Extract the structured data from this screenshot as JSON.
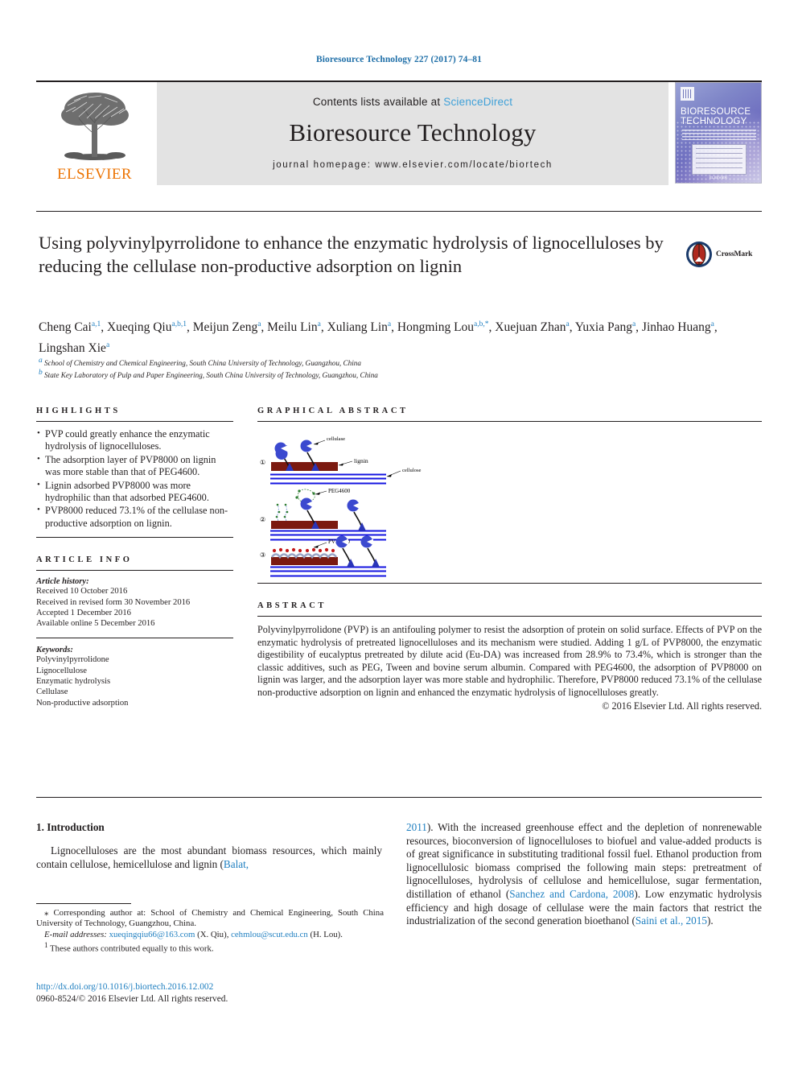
{
  "running_head": "Bioresource Technology 227 (2017) 74–81",
  "masthead": {
    "publisher": "ELSEVIER",
    "contents_prefix": "Contents lists available at ",
    "sciencedirect": "ScienceDirect",
    "journal_title": "Bioresource Technology",
    "homepage": "journal homepage: www.elsevier.com/locate/biortech",
    "cover_title_line1": "BIORESOURCE",
    "cover_title_line2": "TECHNOLOGY",
    "cover_footer": "ELSEVIER"
  },
  "article": {
    "title": "Using polyvinylpyrrolidone to enhance the enzymatic hydrolysis of lignocelluloses by reducing the cellulase non-productive adsorption on lignin",
    "crossmark_label": "CrossMark",
    "authors_line1_parts": [
      {
        "name": "Cheng Cai",
        "sup": "a,1"
      },
      {
        "name": "Xueqing Qiu",
        "sup": "a,b,1"
      },
      {
        "name": "Meijun Zeng",
        "sup": "a"
      },
      {
        "name": "Meilu Lin",
        "sup": "a"
      },
      {
        "name": "Xuliang Lin",
        "sup": "a"
      },
      {
        "name": "Hongming Lou",
        "sup": "a,b,*"
      },
      {
        "name": "Xuejuan Zhan",
        "sup": "a"
      },
      {
        "name": "Yuxia Pang",
        "sup": "a"
      },
      {
        "name": "Jinhao Huang",
        "sup": "a"
      },
      {
        "name": "Lingshan Xie",
        "sup": "a"
      }
    ],
    "affiliations": [
      {
        "sup": "a",
        "text": "School of Chemistry and Chemical Engineering, South China University of Technology, Guangzhou, China"
      },
      {
        "sup": "b",
        "text": "State Key Laboratory of Pulp and Paper Engineering, South China University of Technology, Guangzhou, China"
      }
    ]
  },
  "highlights": {
    "heading": "HIGHLIGHTS",
    "items": [
      "PVP could greatly enhance the enzymatic hydrolysis of lignocelluloses.",
      "The adsorption layer of PVP8000 on lignin was more stable than that of PEG4600.",
      "Lignin adsorbed PVP8000 was more hydrophilic than that adsorbed PEG4600.",
      "PVP8000 reduced 73.1% of the cellulase non-productive adsorption on lignin."
    ]
  },
  "article_info": {
    "heading": "ARTICLE INFO",
    "history_label": "Article history:",
    "history": [
      "Received 10 October 2016",
      "Received in revised form 30 November 2016",
      "Accepted 1 December 2016",
      "Available online 5 December 2016"
    ],
    "keywords_label": "Keywords:",
    "keywords": [
      "Polyvinylpyrrolidone",
      "Lignocellulose",
      "Enzymatic hydrolysis",
      "Cellulase",
      "Non-productive adsorption"
    ]
  },
  "graphical_abstract": {
    "heading": "GRAPHICAL ABSTRACT",
    "panels": [
      {
        "number": "①",
        "labels": [
          "cellulase",
          "lignin",
          "cellulose"
        ]
      },
      {
        "number": "②",
        "labels": [
          "PEG4600"
        ]
      },
      {
        "number": "③",
        "labels": [
          "PVP8000"
        ]
      }
    ],
    "colors": {
      "enzyme": "#2a35b8",
      "lignin": "#7b1a10",
      "cellulose": "#1414e0",
      "peg": "#2f7d32",
      "pvp": "#c41818"
    }
  },
  "abstract": {
    "heading": "ABSTRACT",
    "text": "Polyvinylpyrrolidone (PVP) is an antifouling polymer to resist the adsorption of protein on solid surface. Effects of PVP on the enzymatic hydrolysis of pretreated lignocelluloses and its mechanism were studied. Adding 1 g/L of PVP8000, the enzymatic digestibility of eucalyptus pretreated by dilute acid (Eu-DA) was increased from 28.9% to 73.4%, which is stronger than the classic additives, such as PEG, Tween and bovine serum albumin. Compared with PEG4600, the adsorption of PVP8000 on lignin was larger, and the adsorption layer was more stable and hydrophilic. Therefore, PVP8000 reduced 73.1% of the cellulase non-productive adsorption on lignin and enhanced the enzymatic hydrolysis of lignocelluloses greatly.",
    "copyright": "© 2016 Elsevier Ltd. All rights reserved."
  },
  "body": {
    "section_number_title": "1. Introduction",
    "left_paragraph_pre": "Lignocelluloses are the most abundant biomass resources, which mainly contain cellulose, hemicellulose and lignin (",
    "left_citation": "Balat,",
    "right_citation_open": "2011",
    "right_paragraph": "). With the increased greenhouse effect and the depletion of nonrenewable resources, bioconversion of lignocelluloses to biofuel and value-added products is of great significance in substituting traditional fossil fuel. Ethanol production from lignocellulosic biomass comprised the following main steps: pretreatment of lignocelluloses, hydrolysis of cellulose and hemicellulose, sugar fermentation, distillation of ethanol (",
    "right_citation_1": "Sanchez and Cardona, 2008",
    "right_paragraph_2": "). Low enzymatic hydrolysis efficiency and high dosage of cellulase were the main factors that restrict the industrialization of the second generation bioethanol (",
    "right_citation_2": "Saini et al., 2015",
    "right_paragraph_3": ")."
  },
  "footnotes": {
    "corresponding_marker": "⁎",
    "corresponding": "Corresponding author at: School of Chemistry and Chemical Engineering, South China University of Technology, Guangzhou, China.",
    "email_label": "E-mail addresses:",
    "email_1": "xueqingqiu66@163.com",
    "email_1_owner": "(X. Qiu)",
    "email_2": "cehmlou@scut.edu.cn",
    "email_2_owner": "(H. Lou).",
    "equal_marker": "1",
    "equal_contribution": "These authors contributed equally to this work."
  },
  "doi_block": {
    "doi": "http://dx.doi.org/10.1016/j.biortech.2016.12.002",
    "issn_line": "0960-8524/© 2016 Elsevier Ltd. All rights reserved."
  }
}
